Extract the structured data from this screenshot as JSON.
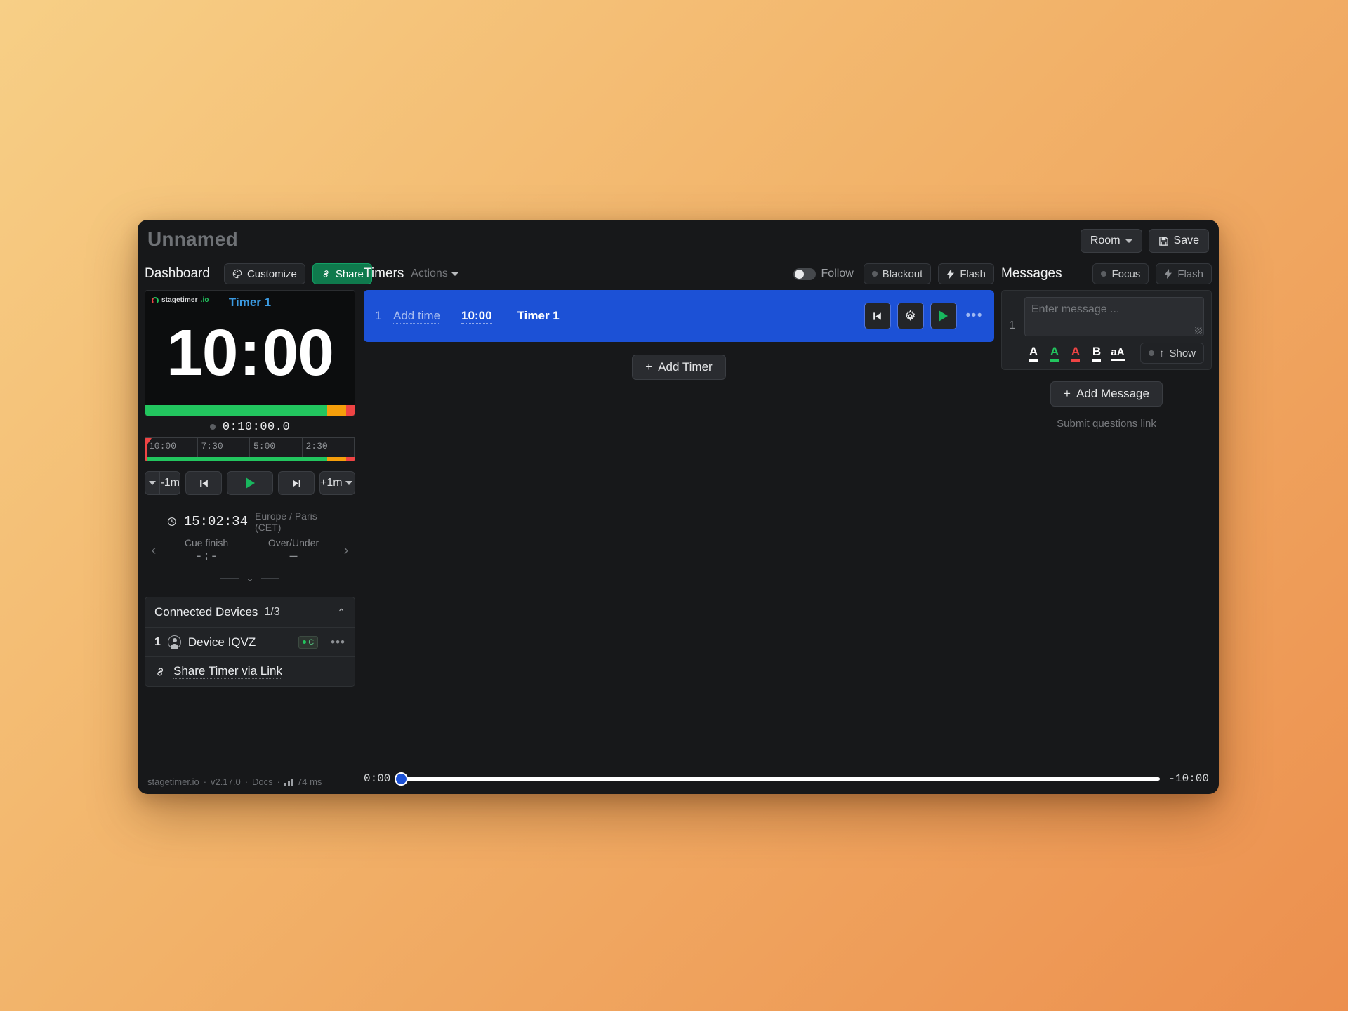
{
  "window": {
    "project_title": "Unnamed",
    "room_label": "Room",
    "save_label": "Save"
  },
  "left": {
    "section_title": "Dashboard",
    "customize_label": "Customize",
    "share_label": "Share",
    "preview": {
      "brand": "stagetimer",
      "brand_tld": ".io",
      "timer_name": "Timer 1",
      "time_hours": "10",
      "time_colon": ":",
      "time_minutes": "00",
      "bar_green_pct": 87,
      "bar_orange_pct": 9,
      "bar_red_pct": 4,
      "green": "#22c55e",
      "orange": "#f59e0b",
      "red": "#ef4444"
    },
    "elapsed": "0:10:00.0",
    "ruler_ticks": [
      "10:00",
      "7:30",
      "5:00",
      "2:30"
    ],
    "transport": {
      "minus_label": "-1m",
      "plus_label": "+1m"
    },
    "clock": {
      "time": "15:02:34",
      "timezone": "Europe / Paris (CET)"
    },
    "cue": {
      "finish_label": "Cue finish",
      "finish_value": "-:-",
      "overunder_label": "Over/Under",
      "overunder_value": "—"
    },
    "devices": {
      "title": "Connected Devices",
      "count": "1/3",
      "rows": [
        {
          "num": "1",
          "name": "Device IQVZ",
          "badge": "C"
        }
      ],
      "share_link_label": "Share Timer via Link"
    },
    "footer": {
      "site": "stagetimer.io",
      "sep1": "·",
      "version": "v2.17.0",
      "sep2": "·",
      "docs": "Docs",
      "sep3": "·",
      "latency": "74 ms"
    }
  },
  "middle": {
    "section_title": "Timers",
    "actions_label": "Actions",
    "follow_label": "Follow",
    "blackout_label": "Blackout",
    "flash_label": "Flash",
    "timers": [
      {
        "num": "1",
        "add_time_label": "Add time",
        "duration": "10:00",
        "name": "Timer 1"
      }
    ],
    "add_timer_label": "Add Timer",
    "add_timer_plus": "+",
    "scrub": {
      "start": "0:00",
      "end": "-10:00",
      "position_pct": 0
    }
  },
  "right": {
    "section_title": "Messages",
    "focus_label": "Focus",
    "flash_label": "Flash",
    "message": {
      "index": "1",
      "placeholder": "Enter message ...",
      "value": ""
    },
    "format_buttons": [
      {
        "glyph": "A",
        "color": "#ffffff",
        "name": "text-color-white"
      },
      {
        "glyph": "A",
        "color": "#22c55e",
        "name": "text-color-green"
      },
      {
        "glyph": "A",
        "color": "#ef4444",
        "name": "text-color-red"
      },
      {
        "glyph": "B",
        "color": "#ffffff",
        "name": "text-bold"
      },
      {
        "glyph": "aA",
        "color": "#ffffff",
        "name": "text-uppercase"
      }
    ],
    "show_label": "Show",
    "add_message_label": "Add Message",
    "add_message_plus": "+",
    "submit_questions_label": "Submit questions link"
  }
}
